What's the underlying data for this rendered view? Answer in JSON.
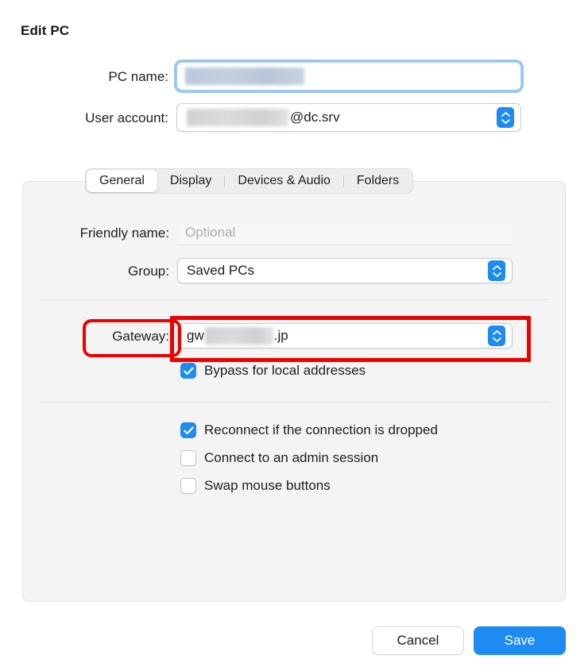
{
  "dialog": {
    "title": "Edit PC"
  },
  "top_form": {
    "pc_name": {
      "label": "PC name:",
      "value": "",
      "redacted": true,
      "focused": true
    },
    "user_account": {
      "label": "User account:",
      "value_suffix": "@dc.srv",
      "redacted": true,
      "control": "popup"
    }
  },
  "tabs": [
    {
      "label": "General",
      "selected": true
    },
    {
      "label": "Display",
      "selected": false
    },
    {
      "label": "Devices & Audio",
      "selected": false
    },
    {
      "label": "Folders",
      "selected": false
    }
  ],
  "general": {
    "friendly_name": {
      "label": "Friendly name:",
      "value": "",
      "placeholder": "Optional"
    },
    "group": {
      "label": "Group:",
      "value": "Saved PCs",
      "control": "popup"
    },
    "gateway": {
      "label": "Gateway:",
      "value_prefix": "gw",
      "value_suffix": ".jp",
      "redacted": true,
      "control": "popup",
      "highlighted": true
    },
    "bypass_local": {
      "label": "Bypass for local addresses",
      "checked": true
    },
    "reconnect": {
      "label": "Reconnect if the connection is dropped",
      "checked": true
    },
    "admin_session": {
      "label": "Connect to an admin session",
      "checked": false
    },
    "swap_mouse": {
      "label": "Swap mouse buttons",
      "checked": false
    }
  },
  "footer": {
    "cancel_label": "Cancel",
    "save_label": "Save"
  },
  "icons": {
    "stepper": "up-down-chevron-icon",
    "checkmark": "checkmark-icon"
  },
  "colors": {
    "accent_blue": "#1d8bf1",
    "annotation_red": "#ee0000",
    "panel_gray": "#f4f4f4",
    "placeholder_gray": "#adadad"
  }
}
